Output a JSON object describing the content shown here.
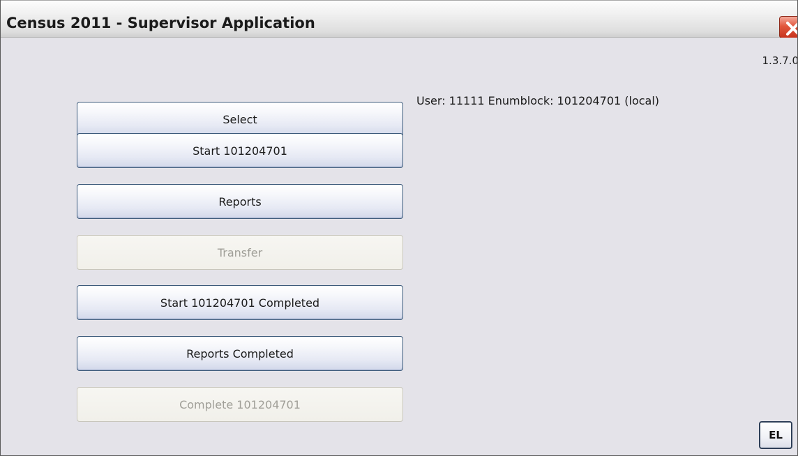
{
  "window": {
    "title": "Census 2011 - Supervisor Application",
    "close_icon": "close-icon",
    "close_color": "#d9472b"
  },
  "version": "1.3.7.0",
  "status_text": "User: 11111 Enumblock: 101204701 (local)",
  "buttons": [
    {
      "label": "Select",
      "enabled": true
    },
    {
      "label": "Start 101204701",
      "enabled": true
    },
    {
      "label": "Reports",
      "enabled": true
    },
    {
      "label": "Transfer",
      "enabled": false
    },
    {
      "label": "Start 101204701 Completed",
      "enabled": true
    },
    {
      "label": "Reports Completed",
      "enabled": true
    },
    {
      "label": "Complete 101204701",
      "enabled": false
    }
  ],
  "language_button": "EL"
}
